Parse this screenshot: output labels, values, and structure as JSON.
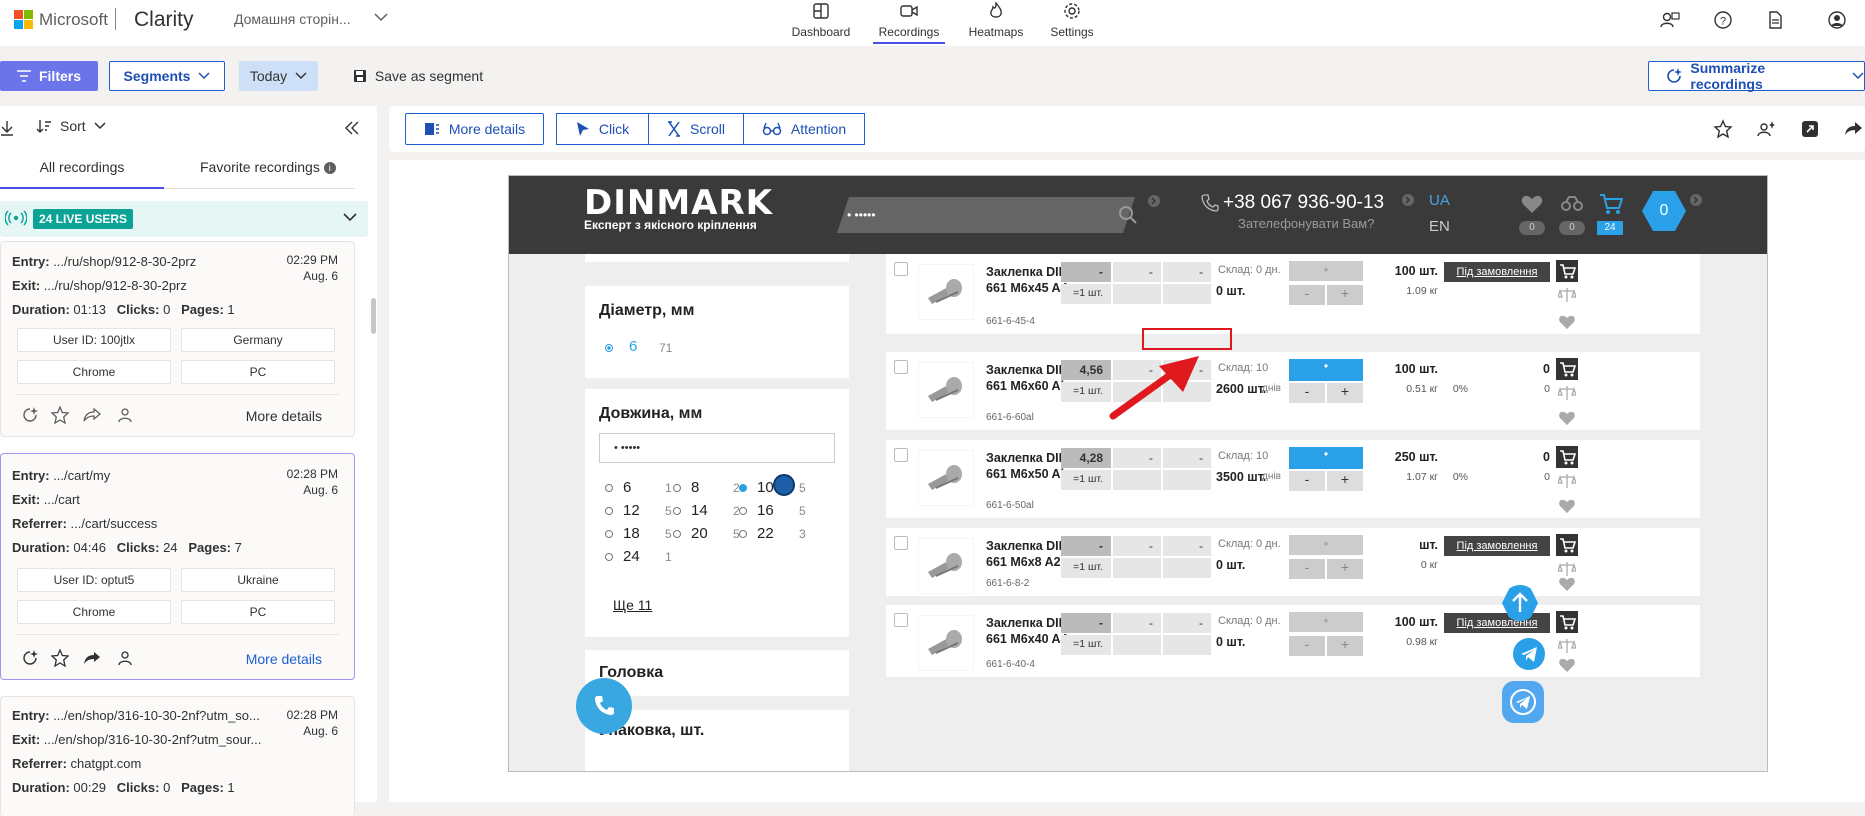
{
  "topbar": {
    "brand": "Microsoft",
    "product": "Clarity",
    "project": "Домашня сторін...",
    "tabs": [
      {
        "label": "Dashboard"
      },
      {
        "label": "Recordings"
      },
      {
        "label": "Heatmaps"
      },
      {
        "label": "Settings"
      }
    ]
  },
  "filterbar": {
    "filters": "Filters",
    "segments": "Segments",
    "today": "Today",
    "save": "Save as segment",
    "summarize": "Summarize recordings"
  },
  "left": {
    "sort": "Sort",
    "tab_all": "All recordings",
    "tab_fav": "Favorite recordings",
    "live": "24 LIVE USERS",
    "more": "More details",
    "cards": [
      {
        "entry": ".../ru/shop/912-8-30-2prz",
        "exit": ".../ru/shop/912-8-30-2prz",
        "duration": "01:13",
        "clicks": "0",
        "pages": "1",
        "time": "02:29 PM",
        "date": "Aug. 6",
        "user": "User ID: 100jtlx",
        "country": "Germany",
        "browser": "Chrome",
        "device": "PC"
      },
      {
        "entry": ".../cart/my",
        "exit": ".../cart",
        "referrer": ".../cart/success",
        "duration": "04:46",
        "clicks": "24",
        "pages": "7",
        "time": "02:28 PM",
        "date": "Aug. 6",
        "user": "User ID: optut5",
        "country": "Ukraine",
        "browser": "Chrome",
        "device": "PC"
      },
      {
        "entry": ".../en/shop/316-10-30-2nf?utm_so...",
        "exit": ".../en/shop/316-10-30-2nf?utm_sour...",
        "referrer": "chatgpt.com",
        "duration": "00:29",
        "clicks": "0",
        "pages": "1",
        "time": "02:28 PM",
        "date": "Aug. 6"
      }
    ],
    "labels": {
      "entry": "Entry:",
      "exit": "Exit:",
      "referrer": "Referrer:",
      "duration": "Duration:",
      "clicks": "Clicks:",
      "pages": "Pages:"
    }
  },
  "viewer": {
    "more_details": "More details",
    "click": "Click",
    "scroll": "Scroll",
    "attention": "Attention"
  },
  "site": {
    "logo": "DINMARK",
    "tagline": "Експерт з якісного кріплення",
    "search": "• •••••",
    "phone": "+38 067 936-90-13",
    "callback": "Зателефонувати Вам?",
    "lang_ua": "UA",
    "lang_en": "EN",
    "fav_count": "0",
    "compare_count": "0",
    "cart_count": "24",
    "basket": "0",
    "diam_title": "Діаметр, мм",
    "diam_val": "6",
    "diam_count": "71",
    "len_title": "Довжина, мм",
    "len_input": "• •••••",
    "lengths": [
      {
        "v": "6",
        "c": "1"
      },
      {
        "v": "8",
        "c": "2"
      },
      {
        "v": "10",
        "c": "5"
      },
      {
        "v": "12",
        "c": "5"
      },
      {
        "v": "14",
        "c": "2"
      },
      {
        "v": "16",
        "c": "5"
      },
      {
        "v": "18",
        "c": "5"
      },
      {
        "v": "20",
        "c": "5"
      },
      {
        "v": "22",
        "c": "3"
      },
      {
        "v": "24",
        "c": "1"
      }
    ],
    "more_link": "Ще 11",
    "head_title": "Головка",
    "pack_title": "Упаковка, шт.",
    "products": [
      {
        "name": "Заклепка DIN 661 M6x45 A4",
        "code": "661-6-45-4",
        "price": "-",
        "p2": "-",
        "p3": "-",
        "min": "=1 шт.",
        "stock": "Склад: 0 дн.",
        "qty": "0 шт.",
        "pack": "100 шт.",
        "weight": "1.09 кг",
        "order": "Під замовлення"
      },
      {
        "name": "Заклепка DIN 661 M6x60 Al",
        "code": "661-6-60al",
        "price": "4,56",
        "p2": "-",
        "p3": "-",
        "min": "=1 шт.",
        "stock": "Склад: 10",
        "qty": "2600 шт.",
        "pack": "100 шт.",
        "weight": "0.51 кг",
        "right": "0",
        "right2": "0",
        "pct": "0%"
      },
      {
        "name": "Заклепка DIN 661 M6x50 Al",
        "code": "661-6-50al",
        "price": "4,28",
        "p2": "-",
        "p3": "-",
        "min": "=1 шт.",
        "stock": "Склад: 10",
        "qty": "3500 шт.",
        "pack": "250 шт.",
        "weight": "1.07 кг",
        "right": "0",
        "right2": "0",
        "pct": "0%"
      },
      {
        "name": "Заклепка DIN 661 M6x8 A2",
        "code": "661-6-8-2",
        "price": "-",
        "p2": "-",
        "p3": "-",
        "min": "=1 шт.",
        "stock": "Склад: 0 дн.",
        "qty": "0 шт.",
        "pack": "шт.",
        "weight": "0 кг",
        "order": "Під замовлення"
      },
      {
        "name": "Заклепка DIN 661 M6x40 A4",
        "code": "661-6-40-4",
        "price": "-",
        "p2": "-",
        "p3": "-",
        "min": "=1 шт.",
        "stock": "Склад: 0 дн.",
        "qty": "0 шт.",
        "pack": "100 шт.",
        "weight": "0.98 кг",
        "order": "Під замовлення"
      }
    ],
    "days_suffix": "днів",
    "plus": "+",
    "minus": "-"
  },
  "colors": {
    "accent": "#4b4ee2",
    "brand_blue": "#2aa0e8",
    "highlight": "#e0191f"
  }
}
